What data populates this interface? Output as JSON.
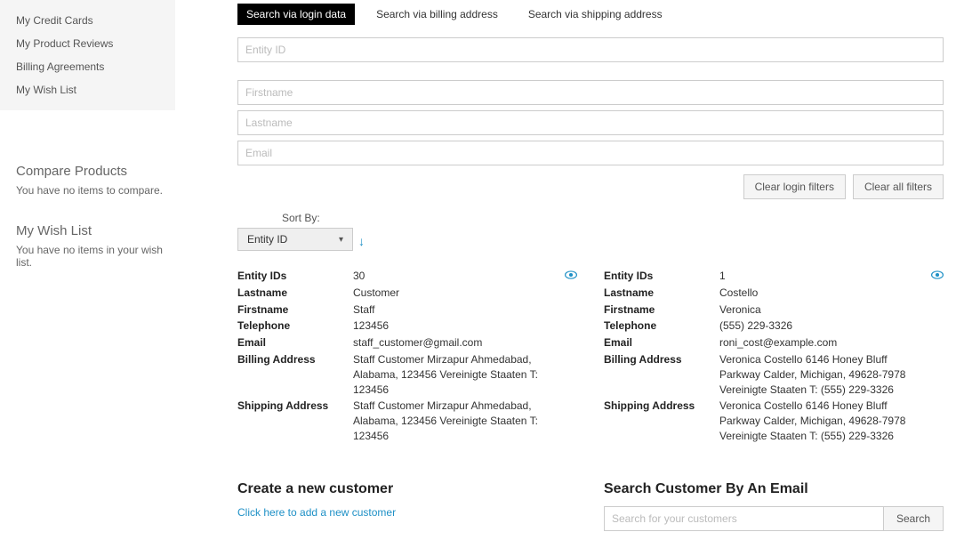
{
  "sidebar": {
    "nav": [
      {
        "label": "My Credit Cards"
      },
      {
        "label": "My Product Reviews"
      },
      {
        "label": "Billing Agreements"
      },
      {
        "label": "My Wish List"
      }
    ],
    "compare": {
      "title": "Compare Products",
      "text": "You have no items to compare."
    },
    "wishlist": {
      "title": "My Wish List",
      "text": "You have no items in your wish list."
    }
  },
  "tabs": {
    "login": "Search via login data",
    "billing": "Search via billing address",
    "shipping": "Search via shipping address"
  },
  "filters": {
    "entity_placeholder": "Entity ID",
    "firstname_placeholder": "Firstname",
    "lastname_placeholder": "Lastname",
    "email_placeholder": "Email"
  },
  "buttons": {
    "clear_login": "Clear login filters",
    "clear_all": "Clear all filters"
  },
  "sort": {
    "label": "Sort By:",
    "selected": "Entity ID"
  },
  "labels": {
    "entity_ids": "Entity IDs",
    "lastname": "Lastname",
    "firstname": "Firstname",
    "telephone": "Telephone",
    "email": "Email",
    "billing_address": "Billing Address",
    "shipping_address": "Shipping Address"
  },
  "customers": [
    {
      "entity_id": "30",
      "lastname": "Customer",
      "firstname": "Staff",
      "telephone": "123456",
      "email": "staff_customer@gmail.com",
      "billing_address": "Staff Customer Mirzapur Ahmedabad, Alabama, 123456 Vereinigte Staaten T: 123456",
      "shipping_address": "Staff Customer Mirzapur Ahmedabad, Alabama, 123456 Vereinigte Staaten T: 123456"
    },
    {
      "entity_id": "1",
      "lastname": "Costello",
      "firstname": "Veronica",
      "telephone": "(555) 229-3326",
      "email": "roni_cost@example.com",
      "billing_address": "Veronica Costello 6146 Honey Bluff Parkway Calder, Michigan, 49628-7978 Vereinigte Staaten T: (555) 229-3326",
      "shipping_address": "Veronica Costello 6146 Honey Bluff Parkway Calder, Michigan, 49628-7978 Vereinigte Staaten T: (555) 229-3326"
    }
  ],
  "create": {
    "title": "Create a new customer",
    "link": "Click here to add a new customer"
  },
  "search": {
    "title": "Search Customer By An Email",
    "placeholder": "Search for your customers",
    "button": "Search"
  }
}
